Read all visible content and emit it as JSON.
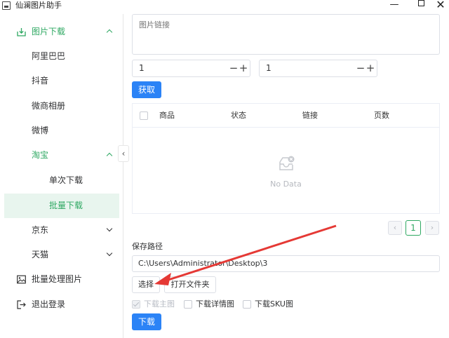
{
  "window": {
    "title": "仙澜图片助手",
    "minimize": "—",
    "close": "✕"
  },
  "sidebar": {
    "image_download": "图片下载",
    "alibaba": "阿里巴巴",
    "douyin": "抖音",
    "weishang": "微商相册",
    "weibo": "微博",
    "taobao": "淘宝",
    "single_download": "单次下载",
    "batch_download": "批量下载",
    "jd": "京东",
    "tmall": "天猫",
    "batch_process": "批量处理图片",
    "logout": "退出登录",
    "collapse": "‹"
  },
  "main": {
    "link_placeholder": "图片链接",
    "start_value": "1",
    "end_value": "1",
    "minus": "−",
    "plus": "+",
    "fetch_button": "获取",
    "table": {
      "columns": [
        "商品",
        "状态",
        "链接",
        "页数"
      ],
      "empty_text": "No Data"
    },
    "pager": {
      "prev": "‹",
      "current_page": "1",
      "next": "›"
    },
    "save_path_label": "保存路径",
    "save_path_value": "C:\\Users\\Administrator\\Desktop\\3",
    "choose_button": "选择",
    "open_folder_button": "打开文件夹",
    "options": {
      "main_image": "下载主图",
      "detail_image": "下载详情图",
      "sku_image": "下载SKU图"
    },
    "download_button": "下载"
  },
  "colors": {
    "accent_green": "#2ea862",
    "primary_blue": "#2b83f6",
    "annotation_red": "#e53935"
  }
}
